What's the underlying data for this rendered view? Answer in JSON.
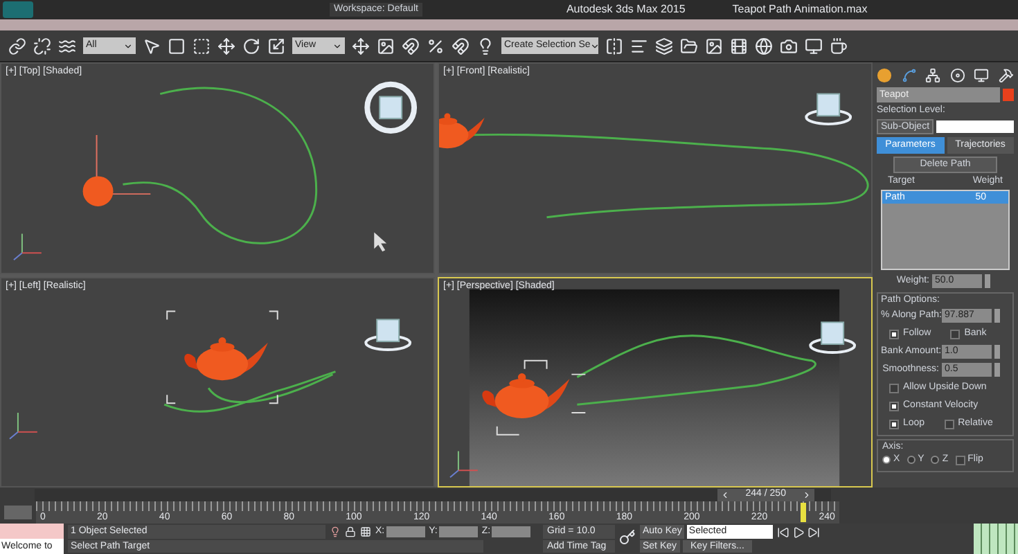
{
  "title_bar": {
    "workspace": "Workspace: Default",
    "app_title": "Autodesk 3ds Max 2015",
    "file_title": "Teapot Path Animation.max"
  },
  "toolbar": {
    "selection_filter": "All",
    "reference_coord": "View",
    "named_selection": "Create Selection Se"
  },
  "viewports": [
    {
      "label": "[+] [Top] [Shaded]",
      "kind": "top",
      "selected": false
    },
    {
      "label": "[+] [Front] [Realistic]",
      "kind": "front",
      "selected": false
    },
    {
      "label": "[+] [Left] [Realistic]",
      "kind": "left",
      "selected": false
    },
    {
      "label": "[+] [Perspective] [Shaded]",
      "kind": "perspective",
      "selected": true
    }
  ],
  "command_panel": {
    "object_name": "Teapot",
    "selection_level": "Selection Level:",
    "sub_object": "Sub-Object",
    "rollout_tabs": [
      {
        "label": "Parameters",
        "selected": true
      },
      {
        "label": "Trajectories",
        "selected": false
      }
    ],
    "delete_path": "Delete Path",
    "target_list": {
      "columns": [
        "Target",
        "Weight"
      ],
      "rows": [
        {
          "target": "Path",
          "weight": "50",
          "selected": true
        }
      ]
    },
    "weight": {
      "label": "Weight:",
      "value": "50.0"
    },
    "path_options": {
      "title": "Path Options:",
      "along_path": {
        "label": "% Along Path:",
        "value": "97.887"
      },
      "rows": [
        {
          "kind": "checks",
          "items": [
            {
              "label": "Follow",
              "checked": true
            },
            {
              "label": "Bank",
              "checked": false
            }
          ]
        },
        {
          "kind": "spinner",
          "label": "Bank Amount:",
          "value": "1.0"
        },
        {
          "kind": "spinner",
          "label": "Smoothness:",
          "value": "0.5"
        },
        {
          "kind": "checks",
          "items": [
            {
              "label": "Allow Upside Down",
              "checked": false
            }
          ]
        },
        {
          "kind": "checks",
          "items": [
            {
              "label": "Constant Velocity",
              "checked": true
            }
          ]
        },
        {
          "kind": "checks",
          "items": [
            {
              "label": "Loop",
              "checked": true
            },
            {
              "label": "Relative",
              "checked": false
            }
          ]
        }
      ]
    },
    "axis": {
      "title": "Axis:",
      "options": [
        {
          "label": "X",
          "selected": true
        },
        {
          "label": "Y",
          "selected": false
        },
        {
          "label": "Z",
          "selected": false
        }
      ],
      "flip": {
        "label": "Flip",
        "checked": false
      }
    }
  },
  "timeline": {
    "frame_display": "244 / 250",
    "level": 0.976,
    "ticks": [
      "0",
      "20",
      "40",
      "60",
      "80",
      "100",
      "120",
      "140",
      "160",
      "180",
      "200",
      "220",
      "240"
    ]
  },
  "status_bar": {
    "selection_count": "1 Object Selected",
    "prompt": "Select Path Target",
    "x_label": "X:",
    "y_label": "Y:",
    "z_label": "Z:",
    "grid": "Grid = 10.0",
    "add_time_tag": "Add Time Tag",
    "auto_key": "Auto Key",
    "key_mode": "Selected",
    "set_key": "Set Key",
    "key_filters": "Key Filters...",
    "listener": "Welcome to"
  }
}
